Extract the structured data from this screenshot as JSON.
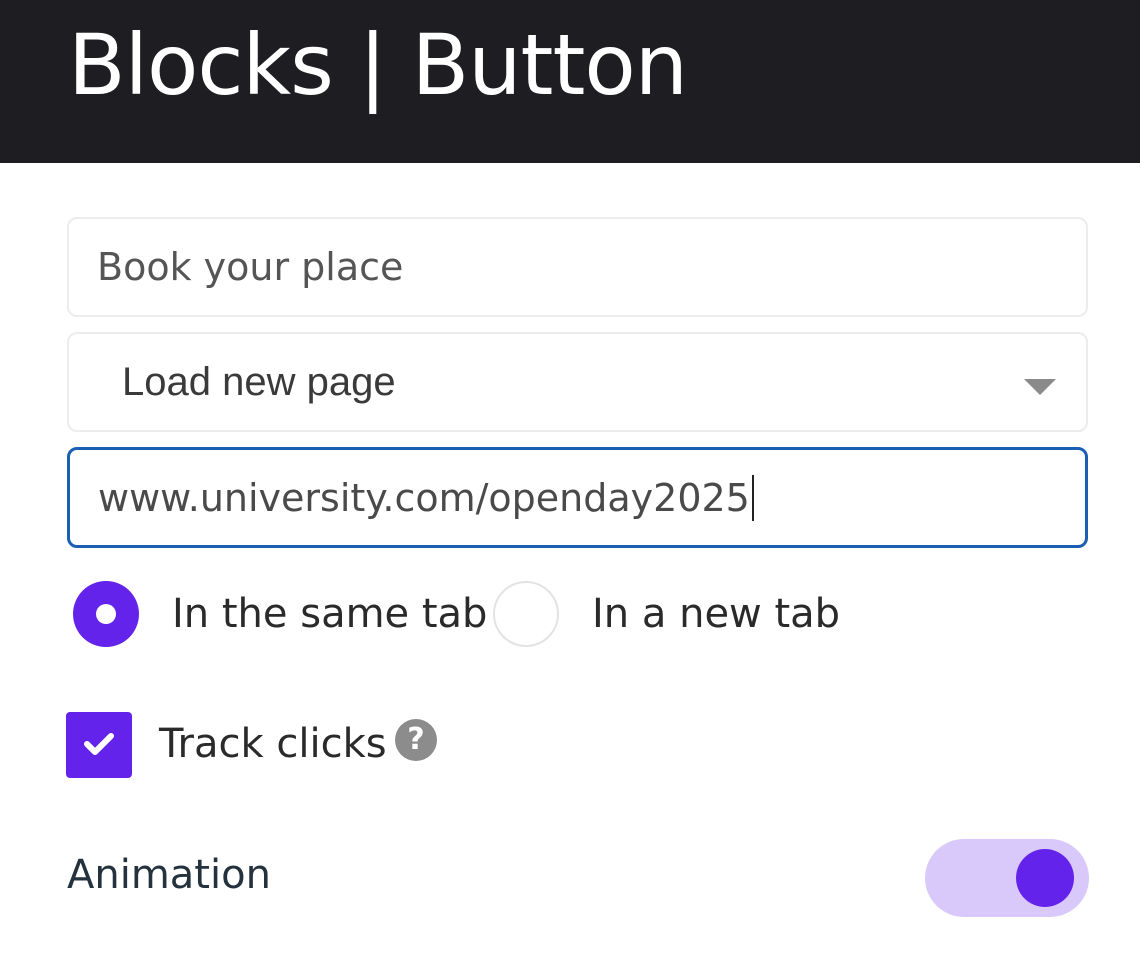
{
  "header": {
    "title": "Blocks | Button"
  },
  "form": {
    "button_label_value": "Book your place",
    "action_select": {
      "selected": "Load new page"
    },
    "url_value": "www.university.com/openday2025",
    "target": {
      "options": [
        "In the same tab",
        "In a new tab"
      ],
      "selected": "In the same tab"
    },
    "track_clicks": {
      "label": "Track clicks",
      "checked": true,
      "help_icon": "question-circle-icon"
    },
    "animation": {
      "label": "Animation",
      "enabled": true
    }
  },
  "colors": {
    "accent": "#6423ea",
    "toggle_track": "#d9c9fb",
    "focus_border": "#1a5fb4",
    "header_bg": "#1e1d22"
  }
}
